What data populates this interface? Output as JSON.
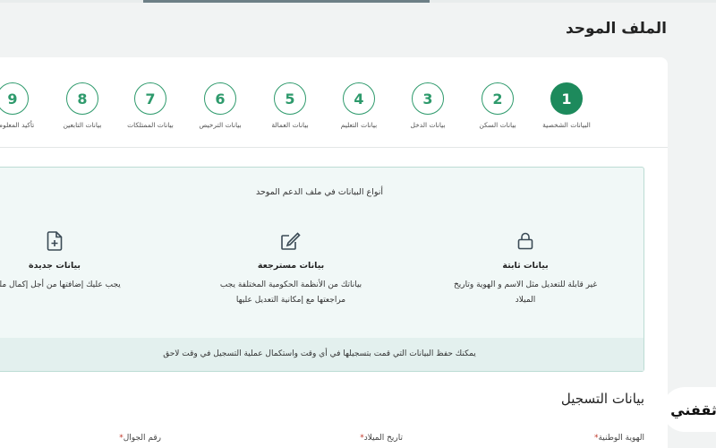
{
  "page_title": "الملف الموحد",
  "steps": [
    {
      "number": "1",
      "label": "البيانات الشخصية",
      "active": true
    },
    {
      "number": "2",
      "label": "بيانات السكن"
    },
    {
      "number": "3",
      "label": "بيانات الدخل"
    },
    {
      "number": "4",
      "label": "بيانات التعليم"
    },
    {
      "number": "5",
      "label": "بيانات العمالة"
    },
    {
      "number": "6",
      "label": "بيانات الترخيص"
    },
    {
      "number": "7",
      "label": "بيانات الممتلكات"
    },
    {
      "number": "8",
      "label": "بيانات التابعين"
    },
    {
      "number": "9",
      "label": "تأكيد المعلومات"
    }
  ],
  "info": {
    "title": "أنواع البيانات في ملف الدعم الموحد",
    "types": [
      {
        "icon": "lock-icon",
        "name": "بيانات ثابتة",
        "desc_line1": "غير قابلة للتعديل مثل الاسم و الهوية وتاريخ",
        "desc_line2": "الميلاد"
      },
      {
        "icon": "edit-icon",
        "name": "بيانات مسترجعة",
        "desc_line1": "بياناتك من الأنظمة الحكومية المختلفة يجب",
        "desc_line2": "مراجعتها مع إمكانية التعديل عليها"
      },
      {
        "icon": "add-file-icon",
        "name": "بيانات جديدة",
        "desc_line1": "يجب عليك إضافتها من أجل إكمال ملفك",
        "desc_line2": ""
      }
    ],
    "footer": "يمكنك حفظ البيانات التي قمت بتسجيلها في أي وقت واستكمال عملية التسجيل في وقت لاحق"
  },
  "registration": {
    "title": "بيانات التسجيل",
    "fields": [
      {
        "label": "الهوية الوطنية"
      },
      {
        "label": "تاريخ الميلاد"
      },
      {
        "label": "رقم الجوال"
      }
    ],
    "required_mark": "*"
  },
  "watermark": "ثقفني",
  "colors": {
    "accent": "#1d8a5c",
    "step_outline": "#2e9a6c",
    "info_bg": "#f1f8f7",
    "info_border": "#bcdcd4"
  }
}
